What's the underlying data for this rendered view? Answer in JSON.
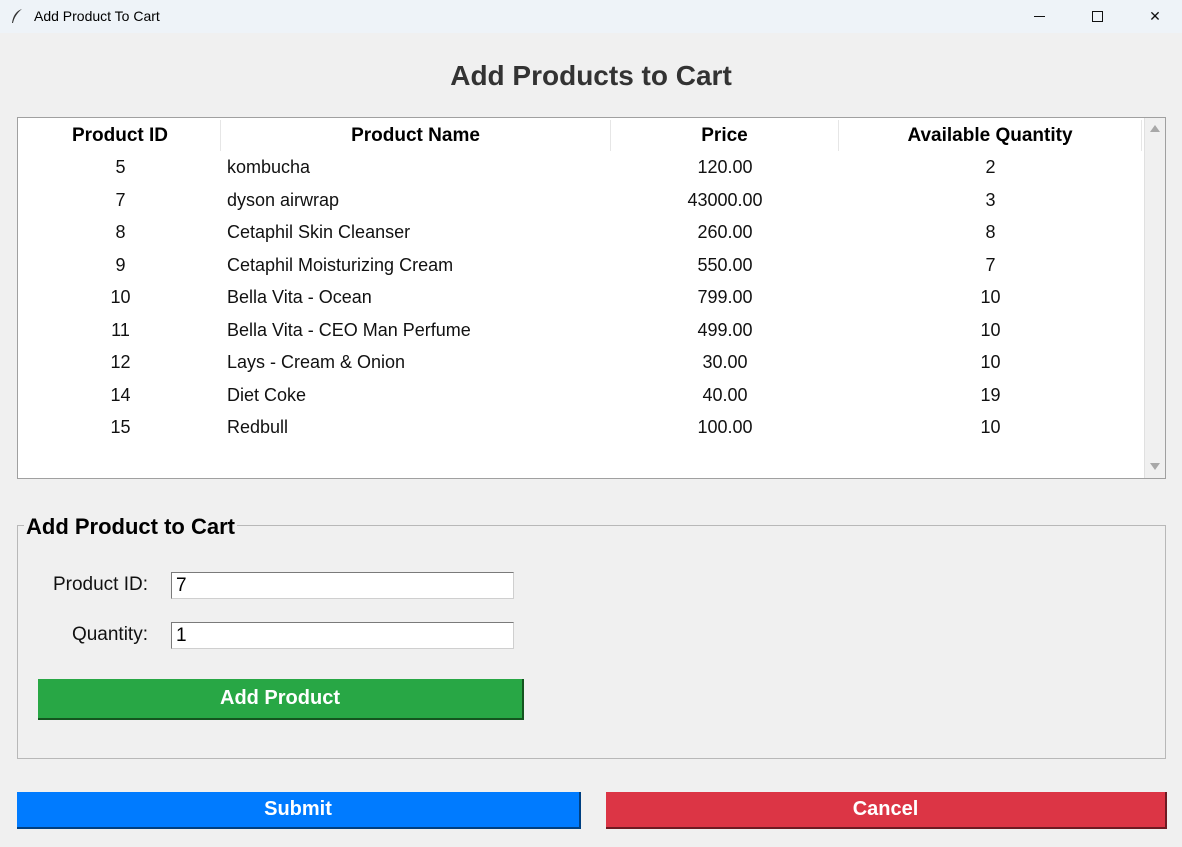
{
  "window": {
    "title": "Add Product To Cart",
    "icon": "feather-icon",
    "controls": {
      "minimize": "minimize-icon",
      "maximize": "maximize-icon",
      "close": "✕"
    }
  },
  "page": {
    "heading": "Add Products to Cart"
  },
  "table": {
    "columns": [
      "Product ID",
      "Product Name",
      "Price",
      "Available Quantity"
    ],
    "rows": [
      [
        "5",
        "kombucha",
        "120.00",
        "2"
      ],
      [
        "7",
        "dyson airwrap",
        "43000.00",
        "3"
      ],
      [
        "8",
        "Cetaphil Skin Cleanser",
        "260.00",
        "8"
      ],
      [
        "9",
        "Cetaphil Moisturizing Cream",
        "550.00",
        "7"
      ],
      [
        "10",
        "Bella Vita - Ocean",
        "799.00",
        "10"
      ],
      [
        "11",
        "Bella Vita - CEO Man Perfume",
        "499.00",
        "10"
      ],
      [
        "12",
        "Lays - Cream & Onion",
        "30.00",
        "10"
      ],
      [
        "14",
        "Diet Coke",
        "40.00",
        "19"
      ],
      [
        "15",
        "Redbull",
        "100.00",
        "10"
      ]
    ]
  },
  "form": {
    "title": "Add Product to Cart",
    "product_id_label": "Product ID:",
    "product_id_value": "7",
    "quantity_label": "Quantity:",
    "quantity_value": "1",
    "add_button": "Add Product"
  },
  "actions": {
    "submit": "Submit",
    "cancel": "Cancel"
  },
  "colors": {
    "add": "#28a745",
    "submit": "#007bff",
    "cancel": "#dc3545"
  }
}
